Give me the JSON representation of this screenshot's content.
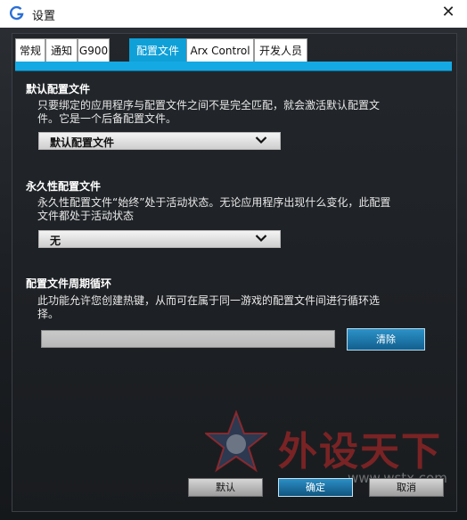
{
  "window": {
    "title": "设置"
  },
  "tabs": [
    {
      "label": "常规"
    },
    {
      "label": "通知"
    },
    {
      "label": "G900"
    },
    {
      "label": "配置文件",
      "active": true
    },
    {
      "label": "Arx Control"
    },
    {
      "label": "开发人员"
    }
  ],
  "default_profile": {
    "title": "默认配置文件",
    "description_lines": [
      "只要绑定的应用程序与配置文件之间不是完全匹配，就会激活默认配置文",
      "件。它是一个后备配置文件。"
    ],
    "dropdown_value": "默认配置文件"
  },
  "persistent_profile": {
    "title": "永久性配置文件",
    "description_lines": [
      "永久性配置文件“始终”处于活动状态。无论应用程序出现什么变化，此配置",
      "文件都处于活动状态"
    ],
    "dropdown_value": "无"
  },
  "profile_cycling": {
    "title": "配置文件周期循环",
    "description_lines": [
      "此功能允许您创建热键，从而可在属于同一游戏的配置文件间进行循环选",
      "择。"
    ],
    "hotkey_value": "",
    "clear_label": "清除"
  },
  "footer": {
    "default_label": "默认",
    "ok_label": "确定",
    "cancel_label": "取消"
  },
  "watermark": {
    "text": "外设天下",
    "url": "www.wstx.com"
  },
  "colors": {
    "accent": "#14a9e3",
    "active_tab": "#0fa0d8",
    "button_blue": "#1a6fa3"
  }
}
